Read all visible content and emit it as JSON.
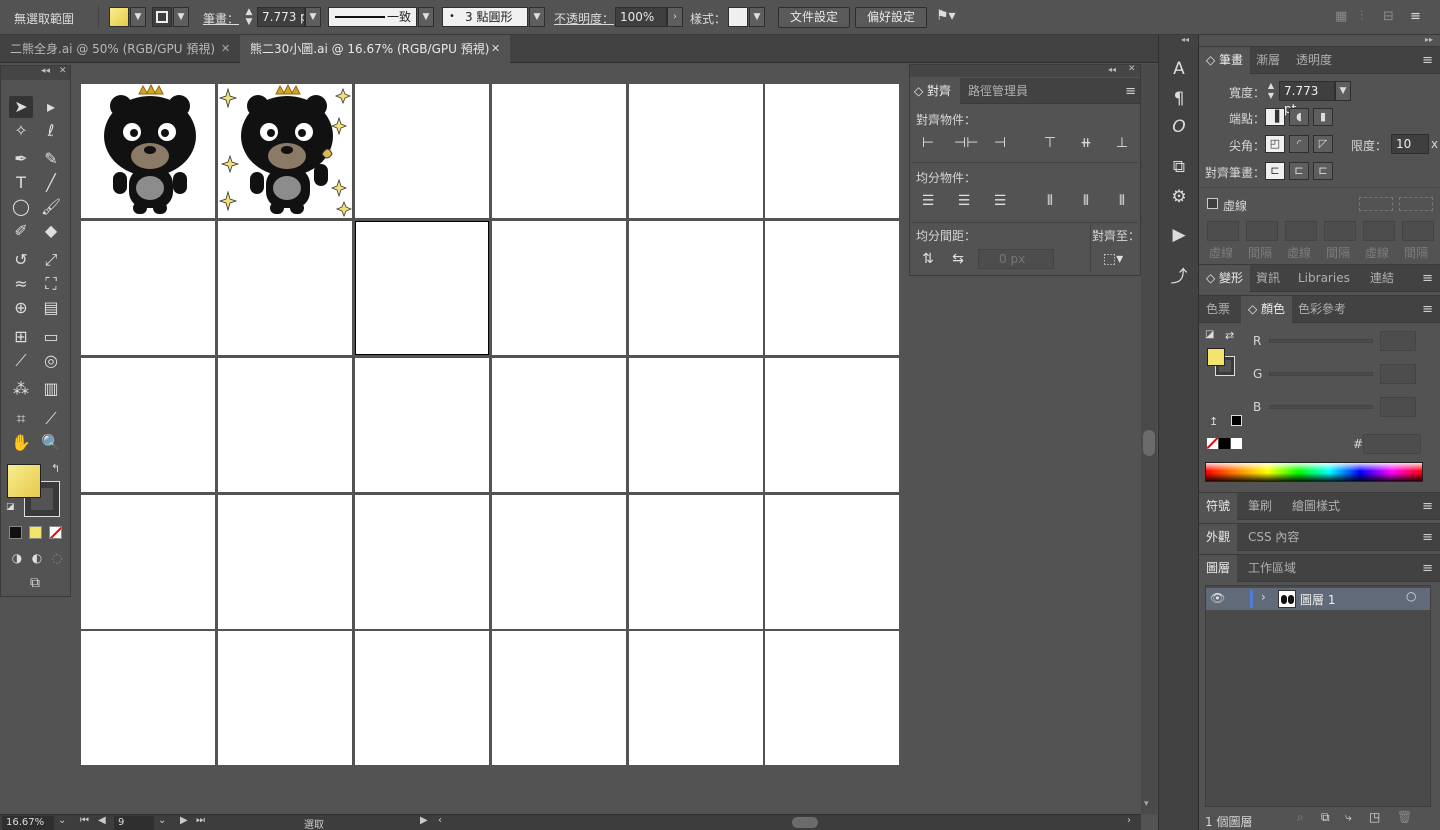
{
  "control_bar": {
    "selection_label": "無選取範圍",
    "stroke_label": "筆畫：",
    "stroke_weight": "7.773 p",
    "stroke_profile": "一致",
    "brush": "3 點圓形",
    "opacity_label": "不透明度：",
    "opacity": "100%",
    "style_label": "樣式：",
    "document_setup": "文件設定",
    "preferences": "偏好設定",
    "fill_color": "#f3e46a"
  },
  "tabs": [
    {
      "title": "二熊全身.ai @ 50% (RGB/GPU 預視)",
      "active": false
    },
    {
      "title": "熊二30小圖.ai @ 16.67% (RGB/GPU 預視)",
      "active": true
    }
  ],
  "status_bar": {
    "zoom": "16.67%",
    "artboard_number": "9",
    "tool_status": "選取"
  },
  "align_panel": {
    "tabs": [
      "對齊",
      "路徑管理員"
    ],
    "align_objects": "對齊物件：",
    "distribute_objects": "均分物件：",
    "distribute_spacing": "均分間距：",
    "align_to": "對齊至：",
    "spacing_value": "0 px"
  },
  "stroke_panel": {
    "tabs": [
      "筆畫",
      "漸層",
      "透明度"
    ],
    "weight_label": "寬度：",
    "weight_value": "7.773 pt",
    "cap_label": "端點：",
    "corner_label": "尖角：",
    "limit_label": "限度：",
    "limit_value": "10",
    "limit_unit": "x",
    "align_label": "對齊筆畫：",
    "dashed_label": "虛線",
    "dash_fields": [
      "虛線",
      "間隔",
      "虛線",
      "間隔",
      "虛線",
      "間隔"
    ]
  },
  "transform_tabs": [
    "變形",
    "資訊",
    "Libraries",
    "連結"
  ],
  "color_panel": {
    "tabs": [
      "色票",
      "顏色",
      "色彩參考"
    ],
    "channels": [
      "R",
      "G",
      "B"
    ],
    "hex_label": "#"
  },
  "symbol_tabs": [
    "符號",
    "筆刷",
    "繪圖樣式"
  ],
  "appearance_tabs": [
    "外觀",
    "CSS 內容"
  ],
  "layers_panel": {
    "tabs": [
      "圖層",
      "工作區域"
    ],
    "layer_name": "圖層 1",
    "footer": "1 個圖層",
    "layer_color": "#4d7bd6"
  },
  "artboards": {
    "rows": 5,
    "cols": 6,
    "selected_index": 8
  }
}
